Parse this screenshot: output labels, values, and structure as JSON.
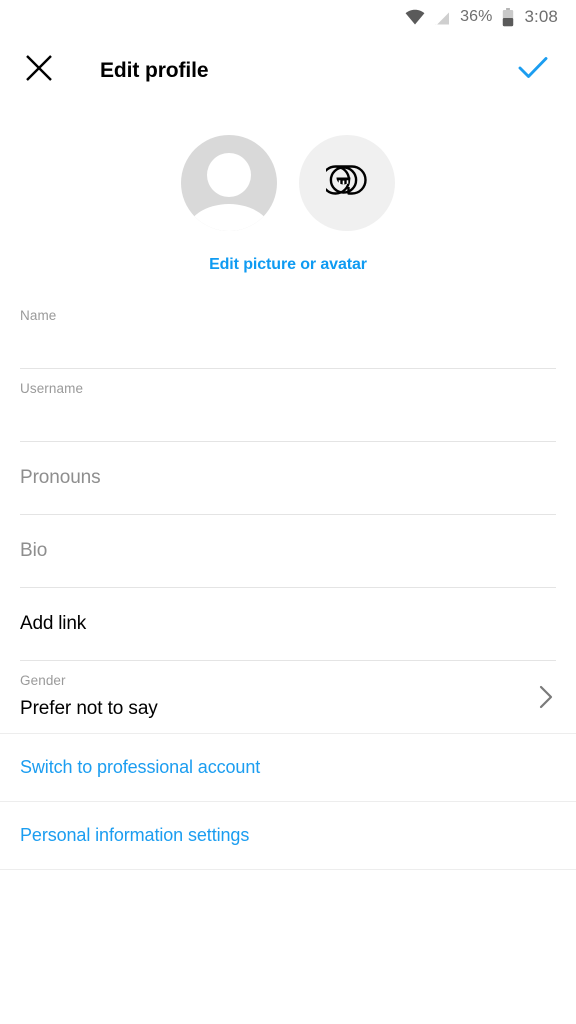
{
  "status_bar": {
    "wifi_icon": "wifi-icon",
    "signal_off_icon": "signal-off-icon",
    "battery_percent": "36%",
    "battery_icon": "battery-icon",
    "time": "3:08"
  },
  "header": {
    "close_icon": "close-icon",
    "title": "Edit profile",
    "done_icon": "checkmark-icon"
  },
  "avatar": {
    "default_avatar_name": "default-profile-avatar",
    "emoji_avatar_name": "emoji-avatar",
    "edit_link": "Edit picture or avatar"
  },
  "form": {
    "fields": [
      {
        "label": "Name",
        "value": "",
        "placeholder": ""
      },
      {
        "label": "Username",
        "value": "",
        "placeholder": ""
      },
      {
        "label": "",
        "value": "",
        "placeholder": "Pronouns"
      },
      {
        "label": "",
        "value": "",
        "placeholder": "Bio"
      },
      {
        "label": "",
        "value": "Add link",
        "placeholder": ""
      },
      {
        "label": "Gender",
        "value": "Prefer not to say",
        "placeholder": ""
      }
    ]
  },
  "links": [
    {
      "label": "Switch to professional account"
    },
    {
      "label": "Personal information settings"
    }
  ],
  "colors": {
    "accent_blue": "#1b9df0",
    "link_blue": "#0f9bf2",
    "label_gray": "#9a9a9a",
    "placeholder_gray": "#8e8e8e",
    "divider": "#e4e4e4",
    "avatar_gray": "#d9d9d9",
    "avatar_light": "#f0f0f0"
  }
}
